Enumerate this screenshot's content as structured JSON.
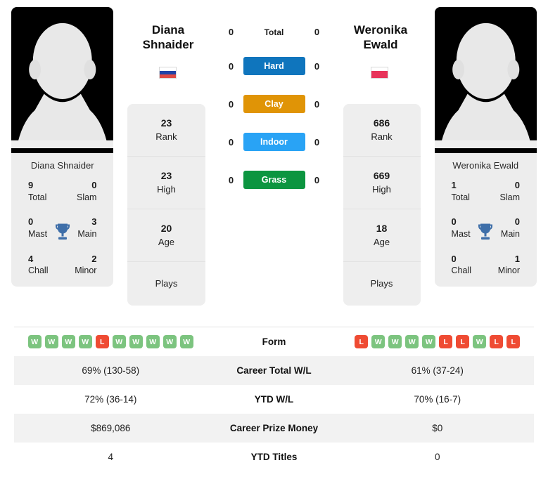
{
  "players": {
    "left": {
      "first_name": "Diana",
      "last_name": "Shnaider",
      "full_name": "Diana Shnaider",
      "flag": "russia-flag",
      "rank": "23",
      "rank_label": "Rank",
      "high": "23",
      "high_label": "High",
      "age": "20",
      "age_label": "Age",
      "plays_label": "Plays",
      "titles": {
        "total": "9",
        "total_label": "Total",
        "slam": "0",
        "slam_label": "Slam",
        "mast": "0",
        "mast_label": "Mast",
        "main": "3",
        "main_label": "Main",
        "chall": "4",
        "chall_label": "Chall",
        "minor": "2",
        "minor_label": "Minor"
      },
      "form": [
        "W",
        "W",
        "W",
        "W",
        "L",
        "W",
        "W",
        "W",
        "W",
        "W"
      ],
      "career_total_wl": "69% (130-58)",
      "ytd_wl": "72% (36-14)",
      "career_prize_money": "$869,086",
      "ytd_titles": "4"
    },
    "right": {
      "first_name": "Weronika",
      "last_name": "Ewald",
      "full_name": "Weronika Ewald",
      "flag": "poland-flag",
      "rank": "686",
      "rank_label": "Rank",
      "high": "669",
      "high_label": "High",
      "age": "18",
      "age_label": "Age",
      "plays_label": "Plays",
      "titles": {
        "total": "1",
        "total_label": "Total",
        "slam": "0",
        "slam_label": "Slam",
        "mast": "0",
        "mast_label": "Mast",
        "main": "0",
        "main_label": "Main",
        "chall": "0",
        "chall_label": "Chall",
        "minor": "1",
        "minor_label": "Minor"
      },
      "form": [
        "L",
        "W",
        "W",
        "W",
        "W",
        "L",
        "L",
        "W",
        "L",
        "L"
      ],
      "career_total_wl": "61% (37-24)",
      "ytd_wl": "70% (16-7)",
      "career_prize_money": "$0",
      "ytd_titles": "0"
    }
  },
  "head_to_head": [
    {
      "label": "Total",
      "left": "0",
      "right": "0",
      "type": "text",
      "color": ""
    },
    {
      "label": "Hard",
      "left": "0",
      "right": "0",
      "type": "pill",
      "color": "#0f75bd"
    },
    {
      "label": "Clay",
      "left": "0",
      "right": "0",
      "type": "pill",
      "color": "#e09406"
    },
    {
      "label": "Indoor",
      "left": "0",
      "right": "0",
      "type": "pill",
      "color": "#29a3f5"
    },
    {
      "label": "Grass",
      "left": "0",
      "right": "0",
      "type": "pill",
      "color": "#0c9540"
    }
  ],
  "stats_table": {
    "rows": [
      {
        "label": "Form",
        "left": "",
        "right": "",
        "type": "form"
      },
      {
        "label": "Career Total W/L",
        "left": "69% (130-58)",
        "right": "61% (37-24)",
        "type": "text"
      },
      {
        "label": "YTD W/L",
        "left": "72% (36-14)",
        "right": "70% (16-7)",
        "type": "text"
      },
      {
        "label": "Career Prize Money",
        "left": "$869,086",
        "right": "$0",
        "type": "text"
      },
      {
        "label": "YTD Titles",
        "left": "4",
        "right": "0",
        "type": "text"
      }
    ]
  },
  "colors": {
    "hard": "#0f75bd",
    "clay": "#e09406",
    "indoor": "#29a3f5",
    "grass": "#0c9540",
    "win": "#7cc47f",
    "loss": "#ef4b33",
    "trophy": "#3f6fa9",
    "card_bg": "#ededed",
    "row_shade": "#f2f2f2"
  }
}
